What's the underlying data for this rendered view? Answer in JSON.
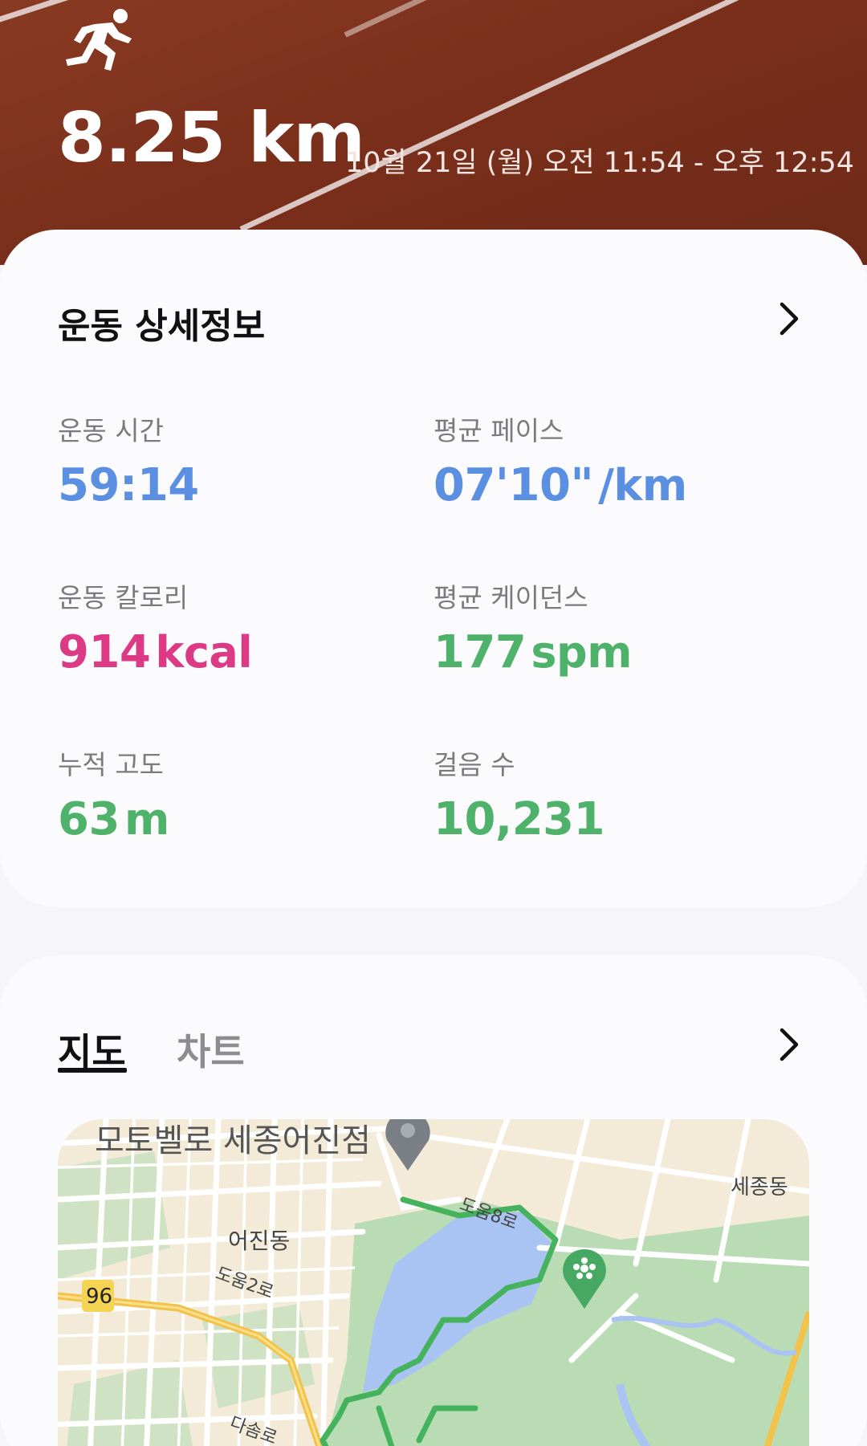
{
  "header": {
    "distance": "8.25 km",
    "datetime": "10월 21일 (월) 오전 11:54 - 오후 12:54"
  },
  "details": {
    "title": "운동 상세정보",
    "stats": [
      {
        "label": "운동 시간",
        "value": "59:14",
        "unit": "",
        "color": "#5b8fe2"
      },
      {
        "label": "평균 페이스",
        "value": "07'10\"",
        "unit": "/km",
        "color": "#5b8fe2"
      },
      {
        "label": "운동 칼로리",
        "value": "914",
        "unit": "kcal",
        "color": "#dd3a86"
      },
      {
        "label": "평균 케이던스",
        "value": "177",
        "unit": "spm",
        "color": "#4fb26a"
      },
      {
        "label": "누적 고도",
        "value": "63",
        "unit": "m",
        "color": "#4fb26a"
      },
      {
        "label": "걸음 수",
        "value": "10,231",
        "unit": "",
        "color": "#4fb26a"
      }
    ]
  },
  "map_section": {
    "tabs": [
      {
        "label": "지도",
        "selected": true
      },
      {
        "label": "차트",
        "selected": false
      }
    ],
    "map_labels": {
      "poi": "모토벨로 세종어진점",
      "district1": "세종동",
      "district2": "어진동",
      "road1": "도움8로",
      "road2": "도움2로",
      "road3": "다솜로",
      "route_number": "96"
    }
  },
  "icons": {
    "runner": "running-person-icon",
    "chevron": "chevron-right-icon",
    "pin": "map-pin-icon",
    "park_marker": "flower-marker-icon"
  }
}
